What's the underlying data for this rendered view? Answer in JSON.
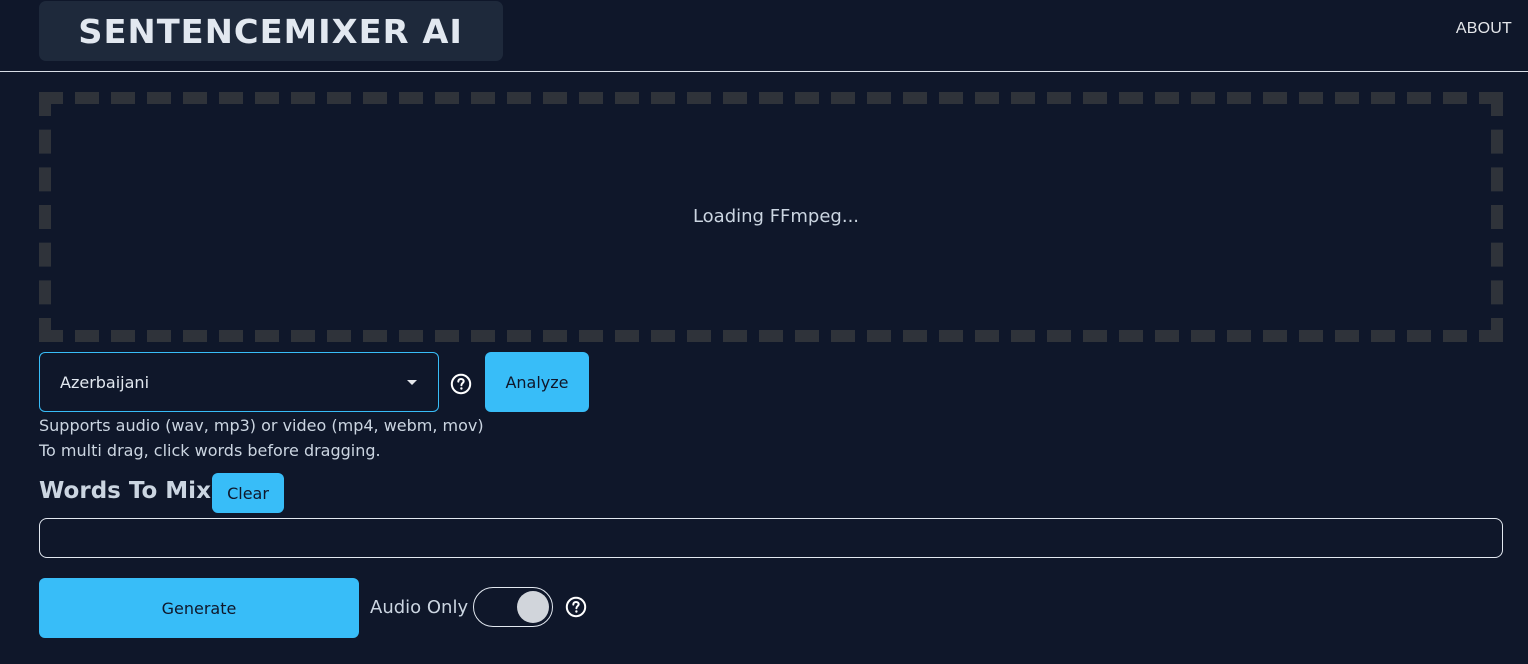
{
  "header": {
    "logo_text": "SENTENCEMIXER AI",
    "about_label": "ABOUT"
  },
  "dropzone": {
    "status": "Loading FFmpeg..."
  },
  "language_select": {
    "value": "Azerbaijani",
    "icon": "chevron-down-icon"
  },
  "buttons": {
    "analyze": "Analyze",
    "clear": "Clear",
    "generate": "Generate"
  },
  "hints": {
    "supported_formats": "Supports audio (wav, mp3) or video (mp4, webm, mov)",
    "multi_drag": "To multi drag, click words before dragging."
  },
  "words_section": {
    "title": "Words To Mix"
  },
  "audio_only": {
    "label": "Audio Only",
    "checked": true
  },
  "colors": {
    "background": "#0f172a",
    "accent": "#38bdf8",
    "text": "#cbd5e1",
    "logo_bg": "#1e293b",
    "dropzone_border": "#2f333a"
  },
  "icons": {
    "help": "question-circle-icon"
  }
}
